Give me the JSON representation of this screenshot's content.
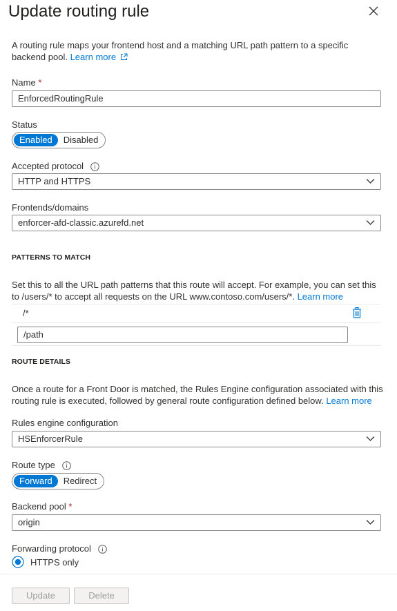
{
  "panel": {
    "title": "Update routing rule",
    "intro": "A routing rule maps your frontend host and a matching URL path pattern to a specific backend pool.",
    "intro_link": "Learn more"
  },
  "name_field": {
    "label": "Name",
    "required_mark": "*",
    "value": "EnforcedRoutingRule"
  },
  "status": {
    "label": "Status",
    "options": [
      "Enabled",
      "Disabled"
    ],
    "selected": "Enabled"
  },
  "accepted_protocol": {
    "label": "Accepted protocol",
    "value": "HTTP and HTTPS"
  },
  "frontends": {
    "label": "Frontends/domains",
    "value": "enforcer-afd-classic.azurefd.net"
  },
  "patterns": {
    "heading": "PATTERNS TO MATCH",
    "description": "Set this to all the URL path patterns that this route will accept. For example, you can set this to /users/* to accept all requests on the URL www.contoso.com/users/*.",
    "link": "Learn more",
    "items": [
      "/*"
    ],
    "new_placeholder": "/path"
  },
  "route_details": {
    "heading": "ROUTE DETAILS",
    "description": "Once a route for a Front Door is matched, the Rules Engine configuration associated with this routing rule is executed, followed by general route configuration defined below.",
    "link": "Learn more"
  },
  "rules_engine": {
    "label": "Rules engine configuration",
    "value": "HSEnforcerRule"
  },
  "route_type": {
    "label": "Route type",
    "options": [
      "Forward",
      "Redirect"
    ],
    "selected": "Forward"
  },
  "backend_pool": {
    "label": "Backend pool",
    "required_mark": "*",
    "value": "origin"
  },
  "forwarding_protocol": {
    "label": "Forwarding protocol",
    "option": "HTTPS only"
  },
  "footer": {
    "update_label": "Update",
    "delete_label": "Delete"
  },
  "colors": {
    "accent": "#0078d4",
    "required": "#a4262c"
  }
}
